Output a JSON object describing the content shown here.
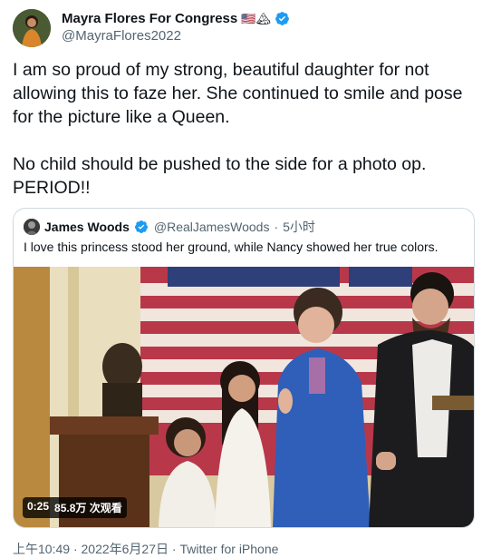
{
  "author": {
    "name": "Mayra Flores For Congress",
    "flags": "🇺🇸🏔",
    "handle": "@MayraFlores2022"
  },
  "tweet": {
    "text": "I am so proud of my strong, beautiful daughter for not allowing this to faze her. She continued to smile and pose for the picture like a Queen.\n\nNo child should be pushed to the side for a photo op. PERIOD!!"
  },
  "quoted": {
    "name": "James Woods",
    "handle": "@RealJamesWoods",
    "separator": "·",
    "time": "5小时",
    "text": "I love this princess stood her ground, while Nancy showed her true colors.",
    "video": {
      "duration": "0:25",
      "views": "85.8万 次观看"
    }
  },
  "footer": {
    "time": "上午10:49",
    "separator": "·",
    "date": "2022年6月27日",
    "separator2": "·",
    "source": "Twitter for iPhone"
  },
  "colors": {
    "verified": "#1d9bf0",
    "secondary_text": "#536471",
    "suit_blue": "#2f5fb8"
  }
}
